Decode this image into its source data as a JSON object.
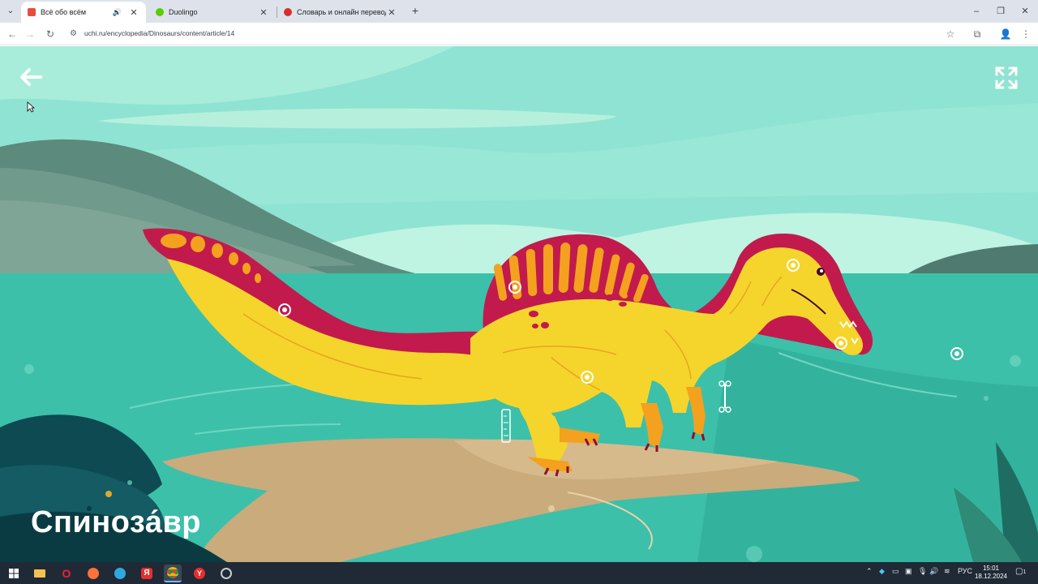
{
  "browser": {
    "tabs": [
      {
        "title": "Всё обо всём",
        "active": true,
        "audio": true,
        "favicon_color": "#e54d42"
      },
      {
        "title": "Duolingo",
        "active": false,
        "audio": false,
        "favicon_color": "#58cc02"
      },
      {
        "title": "Словарь и онлайн перевод на",
        "active": false,
        "audio": false,
        "favicon_color": "#d32f2f"
      }
    ],
    "url": "uchi.ru/encyclopedia/Dinosaurs/content/article/14",
    "window_controls": {
      "minimize": "–",
      "restore": "❐",
      "close": "✕"
    }
  },
  "page": {
    "dinosaur_name": "Спиноза́вр",
    "hotspot_count": 7
  },
  "taskbar": {
    "language": "РУС",
    "time": "15:01",
    "date": "18.12.2024",
    "notifications": "1"
  },
  "colors": {
    "sky": "#8fe3d2",
    "water": "#3cc0aa",
    "sand": "#c9ab7c",
    "dino_body": "#f5d52c",
    "dino_sail": "#c21a4c",
    "sail_stripe": "#f3a11f"
  }
}
